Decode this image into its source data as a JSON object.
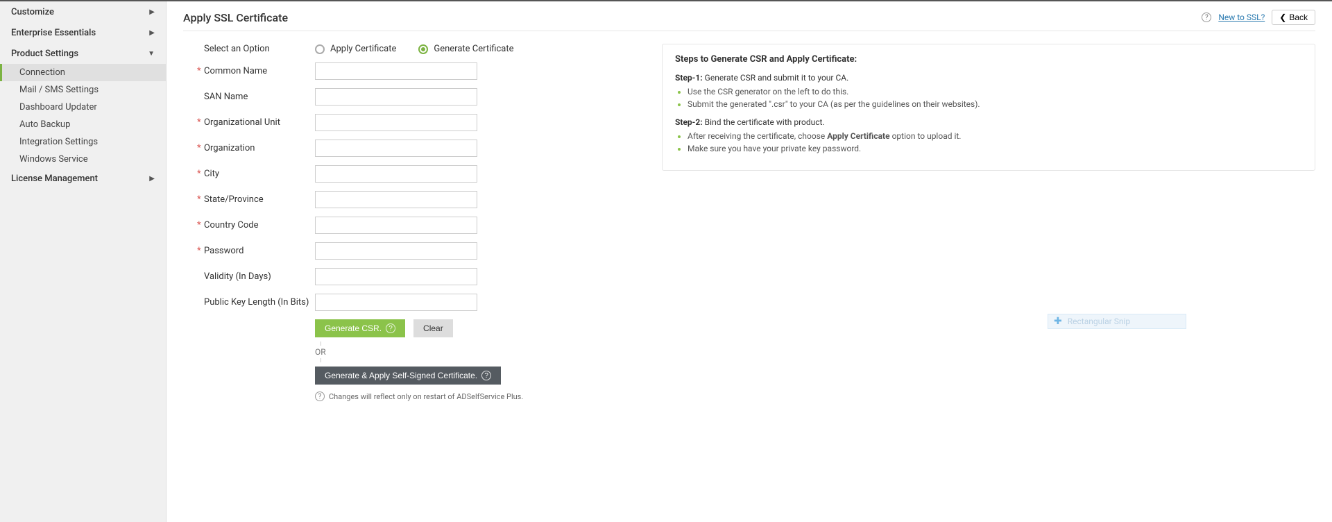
{
  "sidebar": {
    "sections": {
      "customize": "Customize",
      "enterprise": "Enterprise Essentials",
      "product": "Product Settings",
      "license": "License Management"
    },
    "product_items": [
      {
        "label": "Connection",
        "active": true
      },
      {
        "label": "Mail / SMS Settings",
        "active": false
      },
      {
        "label": "Dashboard Updater",
        "active": false
      },
      {
        "label": "Auto Backup",
        "active": false
      },
      {
        "label": "Integration Settings",
        "active": false
      },
      {
        "label": "Windows Service",
        "active": false
      }
    ]
  },
  "header": {
    "title": "Apply SSL Certificate",
    "new_link": "New to SSL?",
    "back": "Back"
  },
  "form": {
    "select_option_label": "Select an Option",
    "radio_apply": "Apply Certificate",
    "radio_generate": "Generate Certificate",
    "common_name": "Common Name",
    "san_name": "SAN Name",
    "org_unit": "Organizational Unit",
    "organization": "Organization",
    "city": "City",
    "state": "State/Province",
    "country_code": "Country Code",
    "password": "Password",
    "validity": "Validity (In Days)",
    "key_length": "Public Key Length (In Bits)",
    "generate_csr_btn": "Generate CSR.",
    "clear_btn": "Clear",
    "or_text": "OR",
    "self_signed_btn": "Generate & Apply Self-Signed Certificate.",
    "footnote": "Changes will reflect only on restart of ADSelfService Plus."
  },
  "info": {
    "title": "Steps to Generate CSR and Apply Certificate:",
    "step1_prefix": "Step-1:",
    "step1": "Generate CSR and submit it to your CA.",
    "step1_bullets": [
      "Use the CSR generator on the left to do this.",
      "Submit the generated \".csr\" to your CA (as per the guidelines on their websites)."
    ],
    "step2_prefix": "Step-2:",
    "step2": "Bind the certificate with product.",
    "step2_bullets_a": "After receiving the certificate, choose ",
    "step2_bullets_a_bold": "Apply Certificate",
    "step2_bullets_a_tail": " option to upload it.",
    "step2_bullets_b": "Make sure you have your private key password."
  },
  "snip": {
    "label": "Rectangular Snip"
  }
}
